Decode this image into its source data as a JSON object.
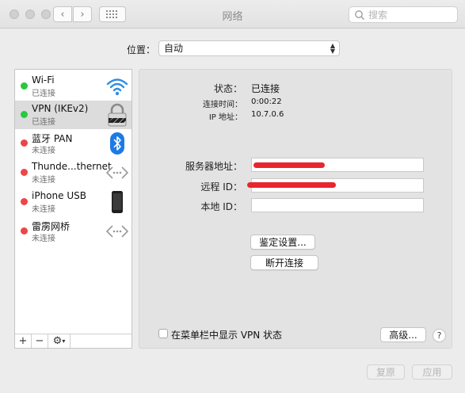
{
  "window": {
    "title": "网络"
  },
  "search": {
    "placeholder": "搜索"
  },
  "location": {
    "label": "位置：",
    "value": "自动"
  },
  "services": [
    {
      "name": "Wi-Fi",
      "status": "已连接",
      "status_color": "#28c840",
      "icon": "wifi-icon"
    },
    {
      "name": "VPN (IKEv2)",
      "status": "已连接",
      "status_color": "#28c840",
      "icon": "lock-icon"
    },
    {
      "name": "蓝牙 PAN",
      "status": "未连接",
      "status_color": "#ec4648",
      "icon": "bluetooth-icon"
    },
    {
      "name": "Thunde...thernet",
      "status": "未连接",
      "status_color": "#ec4648",
      "icon": "ethernet-icon"
    },
    {
      "name": "iPhone USB",
      "status": "未连接",
      "status_color": "#ec4648",
      "icon": "iphone-icon"
    },
    {
      "name": "雷雳网桥",
      "status": "未连接",
      "status_color": "#ec4648",
      "icon": "bridge-icon"
    }
  ],
  "sidebar_footer": {
    "add": "+",
    "remove": "−",
    "gear": "⚙"
  },
  "detail": {
    "status_label": "状态：",
    "status_value": "已连接",
    "connect_time_label": "连接时间：",
    "connect_time_value": "0:00:22",
    "ip_label": "IP 地址：",
    "ip_value": "10.7.0.6",
    "server_label": "服务器地址：",
    "server_value": "",
    "remote_id_label": "远程 ID：",
    "remote_id_value": "",
    "local_id_label": "本地 ID：",
    "local_id_value": "",
    "auth_button": "鉴定设置...",
    "disconnect_button": "断开连接",
    "show_vpn_label": "在菜单栏中显示 VPN 状态",
    "advanced_button": "高级...",
    "help": "?"
  },
  "footer": {
    "revert": "复原",
    "apply": "应用"
  },
  "colors": {
    "connected": "#28c840",
    "disconnected": "#ec4648",
    "redaction": "#e8262e"
  }
}
